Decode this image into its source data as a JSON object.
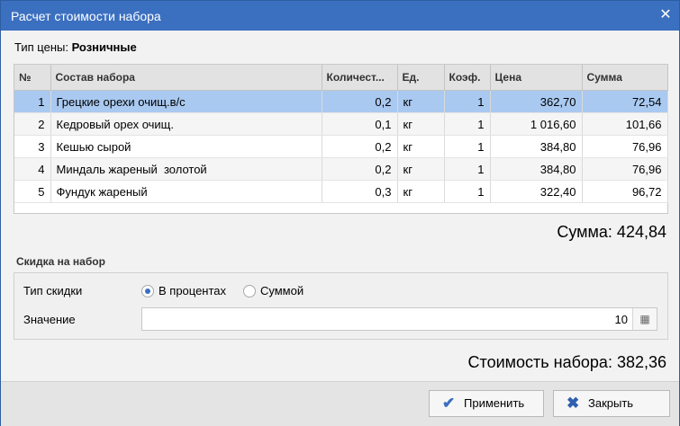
{
  "window": {
    "title": "Расчет стоимости набора",
    "close_glyph": "✕"
  },
  "price_type": {
    "label": "Тип цены:",
    "value": "Розничные"
  },
  "table": {
    "columns": [
      "№",
      "Состав набора",
      "Количест...",
      "Ед.",
      "Коэф.",
      "Цена",
      "Сумма"
    ],
    "rows": [
      {
        "n": "1",
        "name": "Грецкие орехи очищ.в/с",
        "qty": "0,2",
        "unit": "кг",
        "coef": "1",
        "price": "362,70",
        "sum": "72,54"
      },
      {
        "n": "2",
        "name": "Кедровый орех очищ.",
        "qty": "0,1",
        "unit": "кг",
        "coef": "1",
        "price": "1 016,60",
        "sum": "101,66"
      },
      {
        "n": "3",
        "name": "Кешью сырой",
        "qty": "0,2",
        "unit": "кг",
        "coef": "1",
        "price": "384,80",
        "sum": "76,96"
      },
      {
        "n": "4",
        "name": "Миндаль жареный  золотой",
        "qty": "0,2",
        "unit": "кг",
        "coef": "1",
        "price": "384,80",
        "sum": "76,96"
      },
      {
        "n": "5",
        "name": "Фундук жареный",
        "qty": "0,3",
        "unit": "кг",
        "coef": "1",
        "price": "322,40",
        "sum": "96,72"
      }
    ],
    "selected_row": 1
  },
  "total_sum": "Сумма: 424,84",
  "discount": {
    "heading": "Скидка на набор",
    "type_label": "Тип скидки",
    "option_percent": "В процентах",
    "option_amount": "Суммой",
    "selected": "percent",
    "value_label": "Значение",
    "value": "10"
  },
  "total_cost": "Стоимость набора: 382,36",
  "buttons": {
    "apply": "Применить",
    "close": "Закрыть"
  },
  "icons": {
    "check": "check-icon",
    "cross": "cross-icon",
    "calculator": "calculator-icon"
  },
  "colors": {
    "titlebar": "#3b6fc0",
    "selected_row": "#a9c9f0",
    "apply_icon": "#3b6fc0",
    "close_icon": "#2f5fae"
  }
}
